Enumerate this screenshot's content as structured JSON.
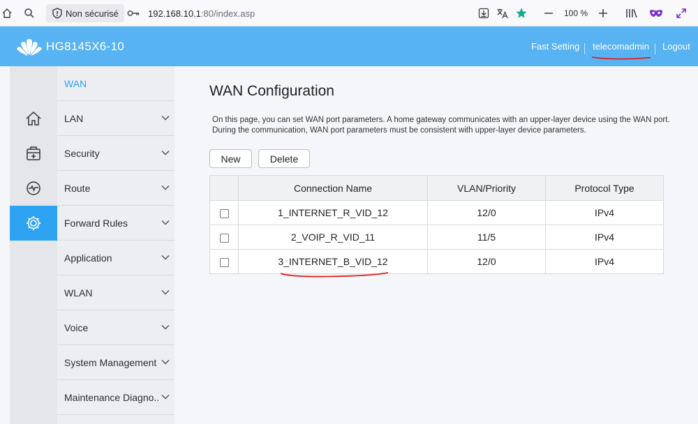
{
  "browser": {
    "security_label": "Non sécurisé",
    "url_host": "192.168.10.1",
    "url_rest": ":80/index.asp",
    "zoom": "100 %"
  },
  "header": {
    "model": "HG8145X6-10",
    "fast_setting": "Fast Setting",
    "user": "telecomadmin",
    "logout": "Logout",
    "bg_color": "#58b3f2"
  },
  "rail": {
    "icons": [
      "home-icon",
      "toolbox-icon",
      "monitor-icon",
      "gear-icon"
    ],
    "active_color": "#2ea3f2"
  },
  "menu": {
    "items": [
      {
        "label": "WAN"
      },
      {
        "label": "LAN"
      },
      {
        "label": "Security"
      },
      {
        "label": "Route"
      },
      {
        "label": "Forward Rules"
      },
      {
        "label": "Application"
      },
      {
        "label": "WLAN"
      },
      {
        "label": "Voice"
      },
      {
        "label": "System Management"
      },
      {
        "label": "Maintenance Diagno.."
      }
    ]
  },
  "page": {
    "title": "WAN Configuration",
    "description": "On this page, you can set WAN port parameters. A home gateway communicates with an upper-layer device using the WAN port. During the communication, WAN port parameters must be consistent with upper-layer device parameters.",
    "new_label": "New",
    "delete_label": "Delete"
  },
  "table": {
    "headers": [
      "Connection Name",
      "VLAN/Priority",
      "Protocol Type"
    ],
    "rows": [
      {
        "name": "1_INTERNET_R_VID_12",
        "vlan": "12/0",
        "protocol": "IPv4"
      },
      {
        "name": "2_VOIP_R_VID_11",
        "vlan": "11/5",
        "protocol": "IPv4"
      },
      {
        "name": "3_INTERNET_B_VID_12",
        "vlan": "12/0",
        "protocol": "IPv4"
      }
    ]
  }
}
